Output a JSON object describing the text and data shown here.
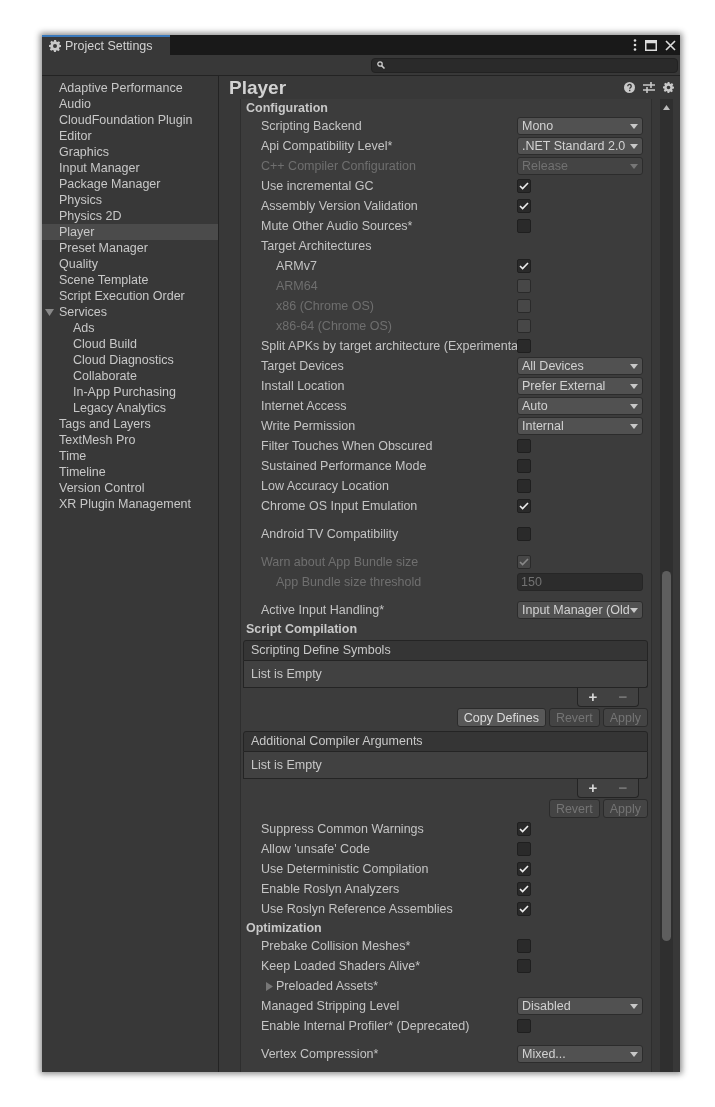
{
  "window": {
    "tab_title": "Project Settings"
  },
  "sidebar": {
    "items": [
      {
        "label": "Adaptive Performance",
        "selected": false
      },
      {
        "label": "Audio",
        "selected": false
      },
      {
        "label": "CloudFoundation Plugin",
        "selected": false
      },
      {
        "label": "Editor",
        "selected": false
      },
      {
        "label": "Graphics",
        "selected": false
      },
      {
        "label": "Input Manager",
        "selected": false
      },
      {
        "label": "Package Manager",
        "selected": false
      },
      {
        "label": "Physics",
        "selected": false
      },
      {
        "label": "Physics 2D",
        "selected": false
      },
      {
        "label": "Player",
        "selected": true
      },
      {
        "label": "Preset Manager",
        "selected": false
      },
      {
        "label": "Quality",
        "selected": false
      },
      {
        "label": "Scene Template",
        "selected": false
      },
      {
        "label": "Script Execution Order",
        "selected": false
      },
      {
        "label": "Services",
        "selected": false,
        "expanded": true,
        "children": [
          {
            "label": "Ads",
            "selected": false
          },
          {
            "label": "Cloud Build",
            "selected": false
          },
          {
            "label": "Cloud Diagnostics",
            "selected": false
          },
          {
            "label": "Collaborate",
            "selected": false
          },
          {
            "label": "In-App Purchasing",
            "selected": false
          },
          {
            "label": "Legacy Analytics",
            "selected": false
          }
        ]
      },
      {
        "label": "Tags and Layers",
        "selected": false
      },
      {
        "label": "TextMesh Pro",
        "selected": false
      },
      {
        "label": "Time",
        "selected": false
      },
      {
        "label": "Timeline",
        "selected": false
      },
      {
        "label": "Version Control",
        "selected": false
      },
      {
        "label": "XR Plugin Management",
        "selected": false
      }
    ]
  },
  "page": {
    "title": "Player"
  },
  "sections": [
    {
      "title": "Configuration",
      "groups": [
        [
          {
            "kind": "dropdown",
            "label": "Scripting Backend",
            "value": "Mono",
            "disabled": false
          },
          {
            "kind": "dropdown",
            "label": "Api Compatibility Level*",
            "value": ".NET Standard 2.0",
            "disabled": false
          },
          {
            "kind": "dropdown",
            "label": "C++ Compiler Configuration",
            "value": "Release",
            "disabled": true
          },
          {
            "kind": "checkbox",
            "label": "Use incremental GC",
            "checked": true,
            "disabled": false
          },
          {
            "kind": "checkbox",
            "label": "Assembly Version Validation",
            "checked": true,
            "disabled": false
          },
          {
            "kind": "checkbox",
            "label": "Mute Other Audio Sources*",
            "checked": false,
            "disabled": false
          },
          {
            "kind": "heading",
            "label": "Target Architectures",
            "children": [
              {
                "kind": "checkbox",
                "label": "ARMv7",
                "checked": true,
                "disabled": false
              },
              {
                "kind": "checkbox",
                "label": "ARM64",
                "checked": false,
                "disabled": true
              },
              {
                "kind": "checkbox",
                "label": "x86 (Chrome OS)",
                "checked": false,
                "disabled": true
              },
              {
                "kind": "checkbox",
                "label": "x86-64 (Chrome OS)",
                "checked": false,
                "disabled": true
              }
            ]
          },
          {
            "kind": "checkbox",
            "label": "Split APKs by target architecture (Experimenta",
            "checked": false,
            "disabled": false
          },
          {
            "kind": "dropdown",
            "label": "Target Devices",
            "value": "All Devices",
            "disabled": false
          },
          {
            "kind": "dropdown",
            "label": "Install Location",
            "value": "Prefer External",
            "disabled": false
          },
          {
            "kind": "dropdown",
            "label": "Internet Access",
            "value": "Auto",
            "disabled": false
          },
          {
            "kind": "dropdown",
            "label": "Write Permission",
            "value": "Internal",
            "disabled": false
          },
          {
            "kind": "checkbox",
            "label": "Filter Touches When Obscured",
            "checked": false,
            "disabled": false
          },
          {
            "kind": "checkbox",
            "label": "Sustained Performance Mode",
            "checked": false,
            "disabled": false
          },
          {
            "kind": "checkbox",
            "label": "Low Accuracy Location",
            "checked": false,
            "disabled": false
          },
          {
            "kind": "checkbox",
            "label": "Chrome OS Input Emulation",
            "checked": true,
            "disabled": false
          }
        ],
        [
          {
            "kind": "checkbox",
            "label": "Android TV Compatibility",
            "checked": false,
            "disabled": false
          }
        ],
        [
          {
            "kind": "checkbox",
            "label": "Warn about App Bundle size",
            "checked": true,
            "disabled": true,
            "children": [
              {
                "kind": "field",
                "label": "App Bundle size threshold",
                "value": "150",
                "disabled": true
              }
            ]
          }
        ],
        [
          {
            "kind": "dropdown",
            "label": "Active Input Handling*",
            "value": "Input Manager (Old",
            "disabled": false
          }
        ]
      ]
    },
    {
      "title": "Script Compilation",
      "groups": [
        [
          {
            "kind": "list",
            "label": "Scripting Define Symbols",
            "empty_text": "List is Empty",
            "add": "+",
            "remove": "−"
          },
          {
            "kind": "buttons",
            "buttons": [
              {
                "label": "Copy Defines",
                "disabled": false
              },
              {
                "label": "Revert",
                "disabled": true
              },
              {
                "label": "Apply",
                "disabled": true
              }
            ]
          },
          {
            "kind": "list",
            "label": "Additional Compiler Arguments",
            "empty_text": "List is Empty",
            "add": "+",
            "remove": "−"
          },
          {
            "kind": "buttons",
            "buttons": [
              {
                "label": "Revert",
                "disabled": true
              },
              {
                "label": "Apply",
                "disabled": true
              }
            ]
          },
          {
            "kind": "checkbox",
            "label": "Suppress Common Warnings",
            "checked": true,
            "disabled": false
          },
          {
            "kind": "checkbox",
            "label": "Allow 'unsafe' Code",
            "checked": false,
            "disabled": false
          },
          {
            "kind": "checkbox",
            "label": "Use Deterministic Compilation",
            "checked": true,
            "disabled": false
          },
          {
            "kind": "checkbox",
            "label": "Enable Roslyn Analyzers",
            "checked": true,
            "disabled": false
          },
          {
            "kind": "checkbox",
            "label": "Use Roslyn Reference Assemblies",
            "checked": true,
            "disabled": false
          }
        ]
      ]
    },
    {
      "title": "Optimization",
      "groups": [
        [
          {
            "kind": "checkbox",
            "label": "Prebake Collision Meshes*",
            "checked": false,
            "disabled": false
          },
          {
            "kind": "checkbox",
            "label": "Keep Loaded Shaders Alive*",
            "checked": false,
            "disabled": false
          },
          {
            "kind": "foldout",
            "label": "Preloaded Assets*",
            "expanded": false
          },
          {
            "kind": "dropdown",
            "label": "Managed Stripping Level",
            "value": "Disabled",
            "disabled": false
          },
          {
            "kind": "checkbox",
            "label": "Enable Internal Profiler* (Deprecated)",
            "checked": false,
            "disabled": false
          }
        ],
        [
          {
            "kind": "dropdown",
            "label": "Vertex Compression*",
            "value": "Mixed...",
            "disabled": false
          }
        ]
      ]
    }
  ]
}
